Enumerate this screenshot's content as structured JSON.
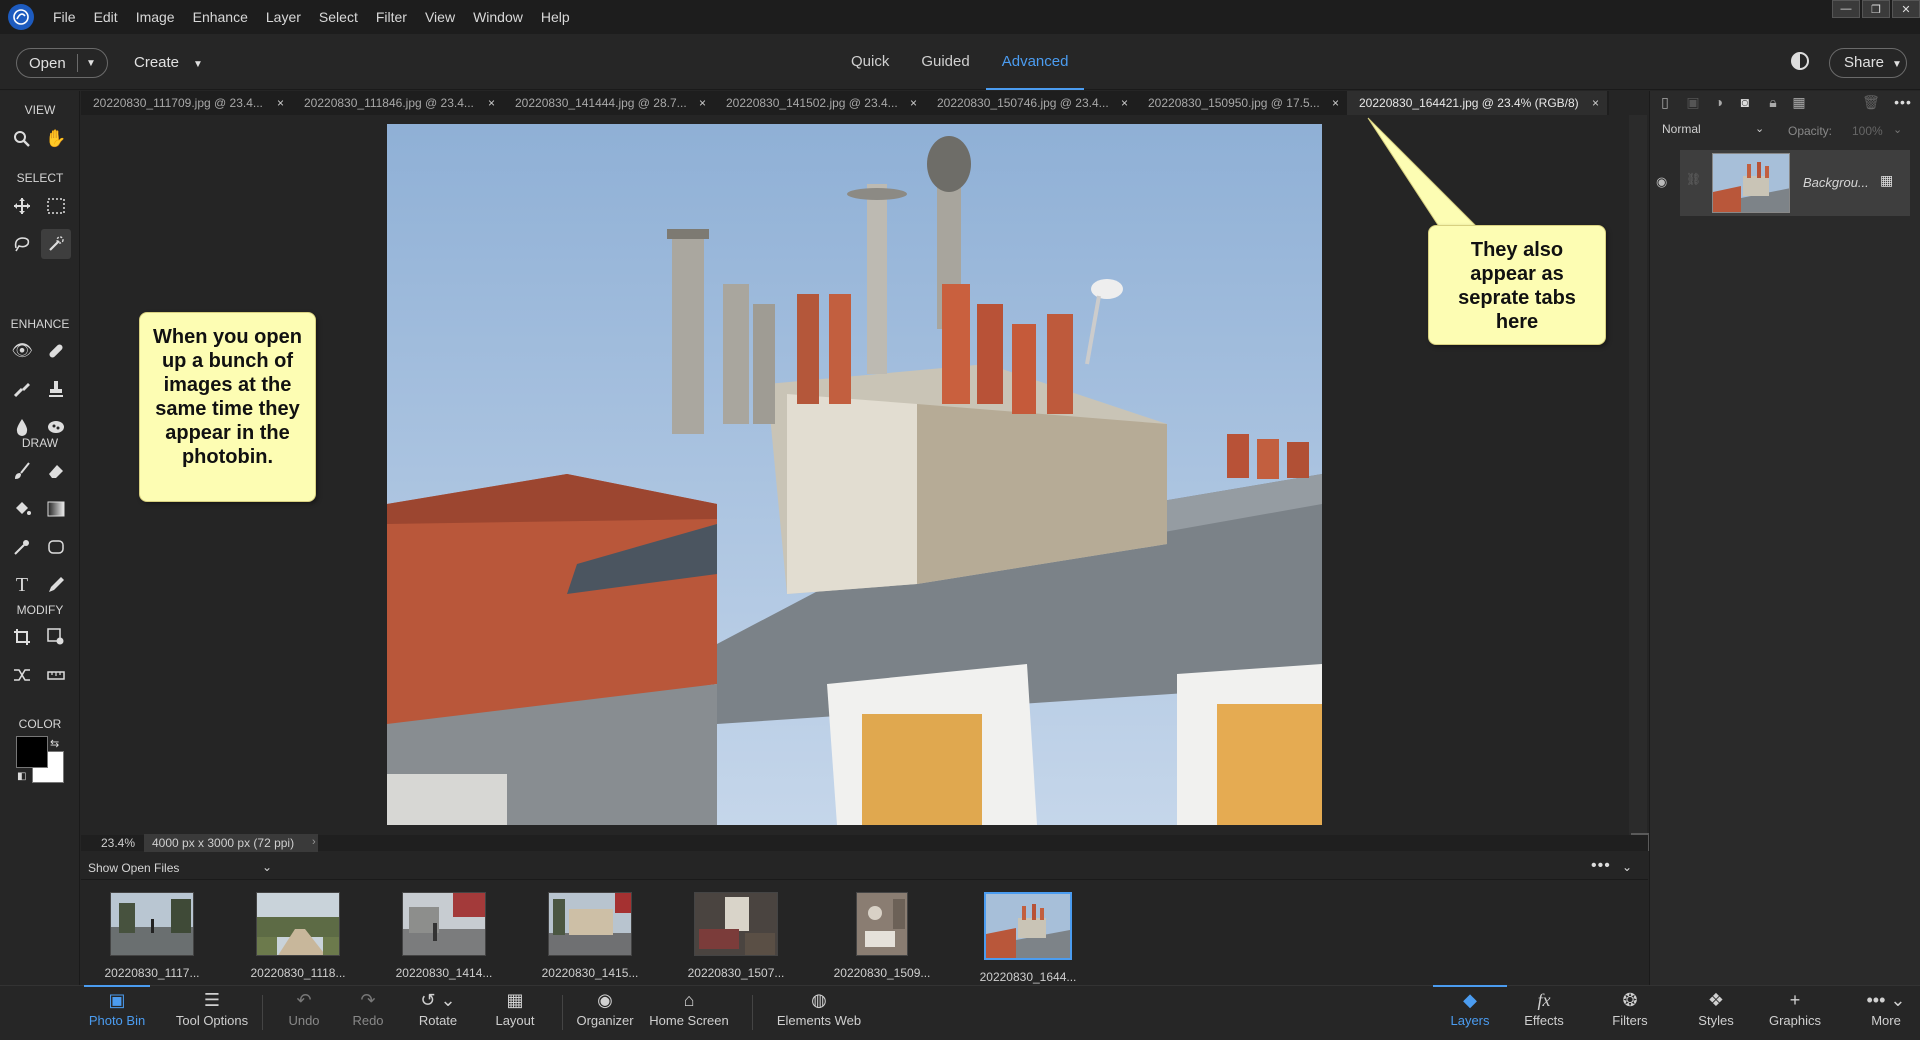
{
  "app": {
    "logo_icon": "photoshop-elements-logo-icon",
    "menu": [
      "File",
      "Edit",
      "Image",
      "Enhance",
      "Layer",
      "Select",
      "Filter",
      "View",
      "Window",
      "Help"
    ],
    "window_controls": {
      "minimize": "—",
      "restore": "❐",
      "close": "✕"
    }
  },
  "toolbar": {
    "open_label": "Open",
    "create_label": "Create",
    "modes": [
      "Quick",
      "Guided",
      "Advanced"
    ],
    "active_mode": "Advanced",
    "share_label": "Share"
  },
  "toolbox": {
    "sections": {
      "view": "VIEW",
      "select": "SELECT",
      "enhance": "ENHANCE",
      "draw": "DRAW",
      "modify": "MODIFY",
      "color": "COLOR"
    },
    "foreground": "#000000",
    "background": "#ffffff"
  },
  "document_tabs": [
    {
      "label": "20220830_111709.jpg @ 23.4...",
      "active": false
    },
    {
      "label": "20220830_111846.jpg @ 23.4...",
      "active": false
    },
    {
      "label": "20220830_141444.jpg @ 28.7...",
      "active": false
    },
    {
      "label": "20220830_141502.jpg @ 23.4...",
      "active": false
    },
    {
      "label": "20220830_150746.jpg @ 23.4...",
      "active": false
    },
    {
      "label": "20220830_150950.jpg @ 17.5...",
      "active": false
    },
    {
      "label": "20220830_164421.jpg @ 23.4% (RGB/8)",
      "active": true
    }
  ],
  "status": {
    "zoom": "23.4%",
    "doc_size": "4000 px x 3000 px (72 ppi)"
  },
  "photo_bin": {
    "show_label": "Show Open Files",
    "items": [
      {
        "label": "20220830_1117..."
      },
      {
        "label": "20220830_1118..."
      },
      {
        "label": "20220830_1414..."
      },
      {
        "label": "20220830_1415..."
      },
      {
        "label": "20220830_1507..."
      },
      {
        "label": "20220830_1509..."
      },
      {
        "label": "20220830_1644...",
        "selected": true
      }
    ]
  },
  "taskbar": {
    "photo_bin": "Photo Bin",
    "tool_options": "Tool Options",
    "undo": "Undo",
    "redo": "Redo",
    "rotate": "Rotate",
    "layout": "Layout",
    "organizer": "Organizer",
    "home_screen": "Home Screen",
    "elements_web": "Elements Web",
    "layers": "Layers",
    "effects": "Effects",
    "filters": "Filters",
    "styles": "Styles",
    "graphics": "Graphics",
    "more": "More"
  },
  "layers_panel": {
    "blend_mode": "Normal",
    "opacity_label": "Opacity:",
    "opacity_value": "100%",
    "layer_name": "Backgrou..."
  },
  "callouts": {
    "left": "When you open up a bunch of images at  the same time they appear in the photobin.",
    "right": "They also appear as seprate tabs here"
  },
  "colors": {
    "accent": "#4b9cf0",
    "callout": "#fdfdb3"
  }
}
